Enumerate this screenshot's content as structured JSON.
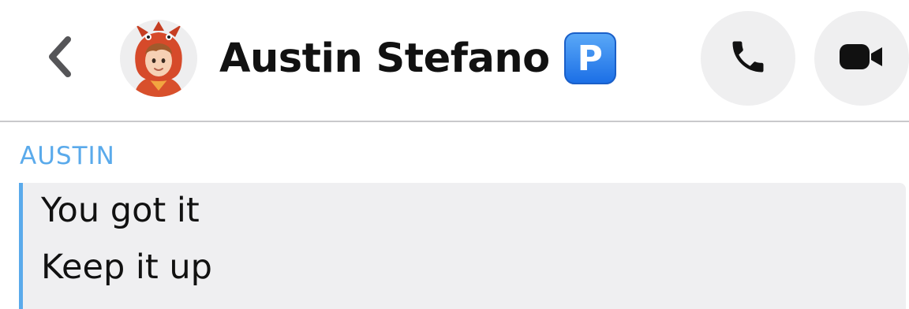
{
  "header": {
    "back_icon": "chevron-left-icon",
    "contact_name": "Austin Stefano",
    "badge_letter": "P",
    "call_icon": "phone-icon",
    "video_icon": "video-camera-icon"
  },
  "colors": {
    "accent": "#5aaaeb",
    "badge": "#1c6fe6",
    "bubble": "#efeff1",
    "button_bg": "#efeff0",
    "text": "#111111"
  },
  "chat": {
    "sender": "AUSTIN",
    "messages": [
      {
        "text": "You got it"
      },
      {
        "text": "Keep it up"
      }
    ]
  }
}
